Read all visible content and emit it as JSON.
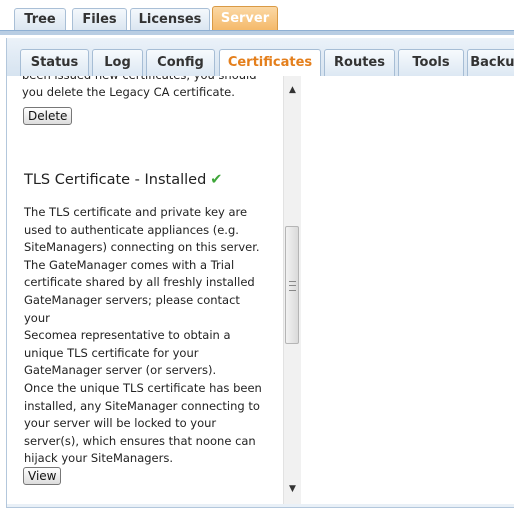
{
  "top_tabs": [
    {
      "label": "Tree"
    },
    {
      "label": "Files"
    },
    {
      "label": "Licenses"
    },
    {
      "label": "Server",
      "active": true
    }
  ],
  "sub_tabs": [
    {
      "label": "Status"
    },
    {
      "label": "Log"
    },
    {
      "label": "Config"
    },
    {
      "label": "Certificates",
      "active": true
    },
    {
      "label": "Routes"
    },
    {
      "label": "Tools"
    },
    {
      "label": "Backup"
    }
  ],
  "legacy": {
    "lines": [
      "been issued new certificates, you should",
      "you delete the Legacy CA certificate."
    ],
    "delete_label": "Delete"
  },
  "tls": {
    "heading": "TLS Certificate - Installed",
    "status_icon": "check-icon",
    "paragraph_lines": [
      "The TLS certificate and private key are",
      "used to authenticate appliances (e.g.",
      "SiteManagers) connecting on this server.",
      "The GateManager comes with a Trial",
      "certificate shared by all freshly installed",
      "GateManager servers; please contact",
      "your",
      "Secomea representative to obtain a",
      "unique TLS certificate for your",
      "GateManager server (or servers).",
      "Once the unique TLS certificate has been",
      "installed, any SiteManager connecting to",
      "your server will be locked to your",
      "server(s), which ensures that noone can",
      "hijack your SiteManagers."
    ],
    "view_label": "View"
  },
  "colors": {
    "active_tab": "#f4b868",
    "active_subtab_text": "#e47f1c",
    "check": "#3ea639"
  }
}
